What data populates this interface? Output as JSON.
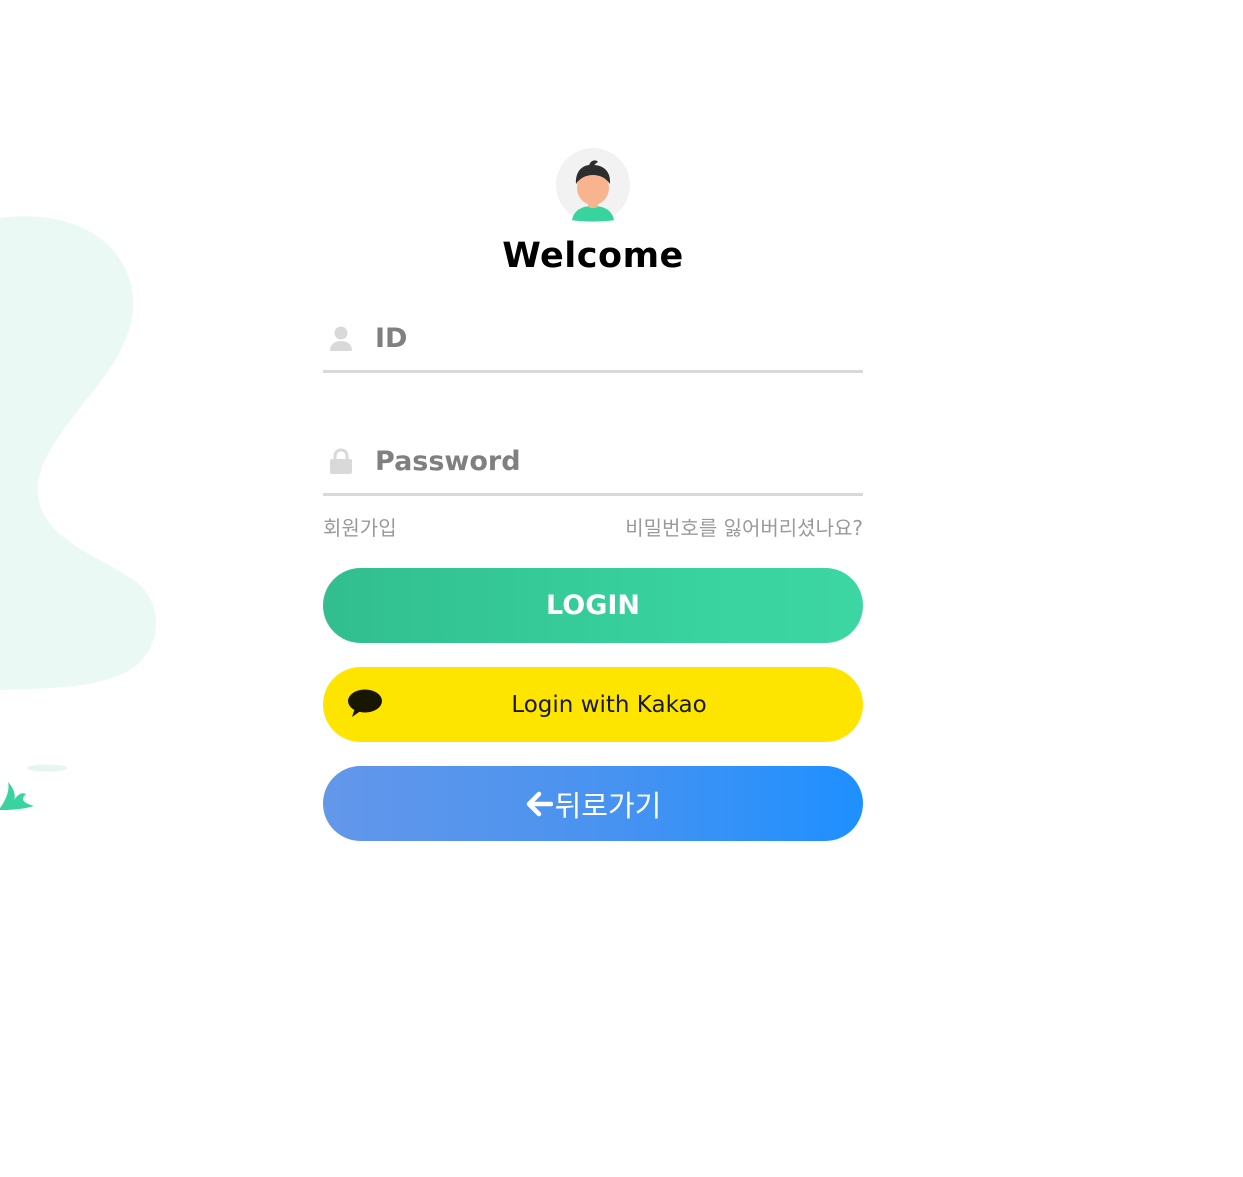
{
  "header": {
    "avatar_icon": "user-avatar-icon",
    "title": "Welcome"
  },
  "form": {
    "id_field": {
      "icon": "user-icon",
      "placeholder": "ID",
      "value": ""
    },
    "password_field": {
      "icon": "lock-icon",
      "placeholder": "Password",
      "value": ""
    }
  },
  "links": {
    "signup": "회원가입",
    "forgot_password": "비밀번호를 잃어버리셨나요?"
  },
  "buttons": {
    "login": "LOGIN",
    "kakao": "Login with Kakao",
    "kakao_icon": "speech-bubble-icon",
    "back": "뒤로가기",
    "back_icon": "arrow-left-icon"
  },
  "colors": {
    "login_green": "#38d39f",
    "kakao_yellow": "#fee500",
    "back_blue": "#1e90ff",
    "blob_mint": "#eaf9f4",
    "underline_gray": "#d9d9d9"
  }
}
